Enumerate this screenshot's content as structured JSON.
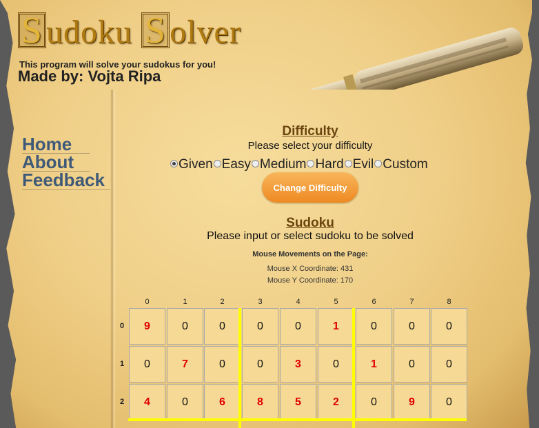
{
  "header": {
    "title_first_cap": "S",
    "title_first_rest": "udoku ",
    "title_second_cap": "S",
    "title_second_rest": "olver",
    "tagline": "This program will solve your sudokus for you!",
    "author": "Made by: Vojta Ripa"
  },
  "nav": {
    "items": [
      {
        "label": "Home"
      },
      {
        "label": "About"
      },
      {
        "label": "Feedback"
      }
    ]
  },
  "difficulty": {
    "heading": "Difficulty",
    "prompt": "Please select your difficulty",
    "options": [
      "Given",
      "Easy",
      "Medium",
      "Hard",
      "Evil",
      "Custom"
    ],
    "selected": "Given",
    "button_label": "Change Difficulty"
  },
  "sudoku": {
    "heading": "Sudoku",
    "prompt": "Please input or select sudoku to be solved",
    "mouse_title": "Mouse Movements on the Page:",
    "mouse_x": "Mouse X Coordinate: 431",
    "mouse_y": "Mouse Y Coordinate: 170",
    "column_headers": [
      "0",
      "1",
      "2",
      "3",
      "4",
      "5",
      "6",
      "7",
      "8"
    ],
    "row_headers": [
      "0",
      "1",
      "2"
    ],
    "rows": [
      [
        {
          "v": "9",
          "given": true
        },
        {
          "v": "0"
        },
        {
          "v": "0"
        },
        {
          "v": "0"
        },
        {
          "v": "0"
        },
        {
          "v": "1",
          "given": true
        },
        {
          "v": "0"
        },
        {
          "v": "0"
        },
        {
          "v": "0"
        }
      ],
      [
        {
          "v": "0"
        },
        {
          "v": "7",
          "given": true
        },
        {
          "v": "0"
        },
        {
          "v": "0"
        },
        {
          "v": "3",
          "given": true
        },
        {
          "v": "0"
        },
        {
          "v": "1",
          "given": true
        },
        {
          "v": "0"
        },
        {
          "v": "0"
        }
      ],
      [
        {
          "v": "4",
          "given": true
        },
        {
          "v": "0"
        },
        {
          "v": "6",
          "given": true
        },
        {
          "v": "8",
          "given": true
        },
        {
          "v": "5",
          "given": true
        },
        {
          "v": "2",
          "given": true
        },
        {
          "v": "0"
        },
        {
          "v": "9",
          "given": true
        },
        {
          "v": "0"
        }
      ]
    ]
  },
  "colors": {
    "given_digit": "#e00000",
    "box_separator": "#ffff00",
    "nav_link": "#3f5a78",
    "button": "#ee8a22"
  }
}
